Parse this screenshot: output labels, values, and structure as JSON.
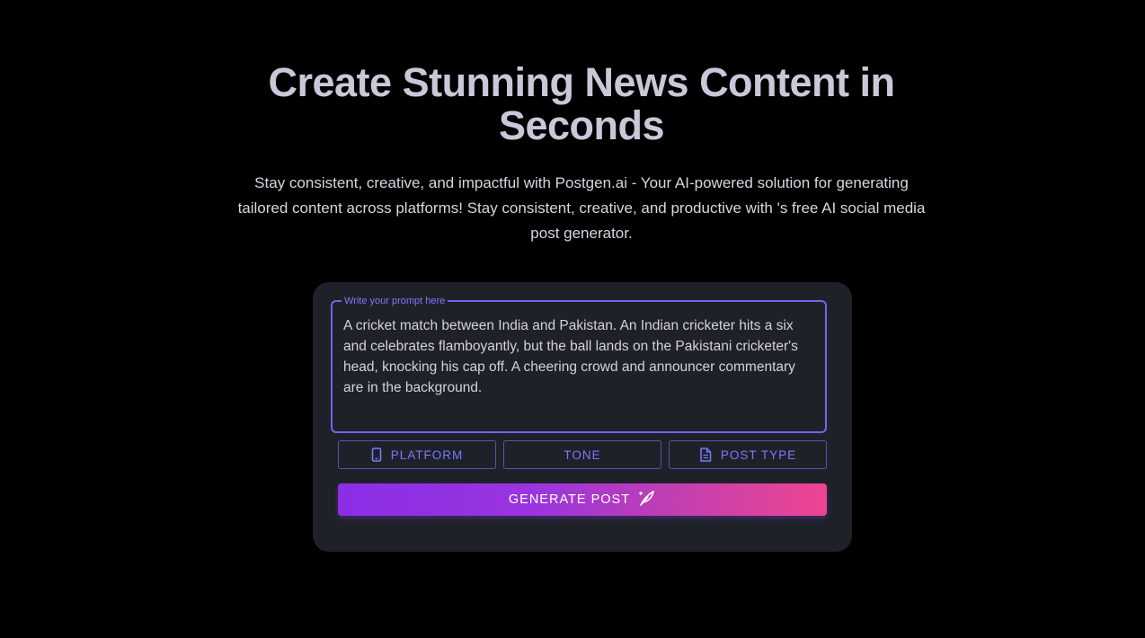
{
  "hero": {
    "title": "Create Stunning News Content in Seconds",
    "subtitle": "Stay consistent, creative, and impactful with Postgen.ai - Your AI-powered solution for generating tailored content across platforms! Stay consistent, creative, and productive with 's free AI social media post generator."
  },
  "prompt": {
    "label": "Write your prompt here",
    "value": "A cricket match between India and Pakistan. An Indian cricketer hits a six and celebrates flamboyantly, but the ball lands on the Pakistani cricketer's head, knocking his cap off. A cheering crowd and announcer commentary are in the background."
  },
  "options": {
    "platform": {
      "label": "PLATFORM",
      "icon": "smartphone-icon"
    },
    "tone": {
      "label": "TONE"
    },
    "post_type": {
      "label": "POST TYPE",
      "icon": "document-icon"
    }
  },
  "generate": {
    "label": "GENERATE POST",
    "icon": "quill-pen-icon"
  },
  "colors": {
    "background": "#000000",
    "card": "#1f2129",
    "accent": "#6a67f0",
    "gradient_start": "#8b2ee6",
    "gradient_end": "#ee4592"
  }
}
